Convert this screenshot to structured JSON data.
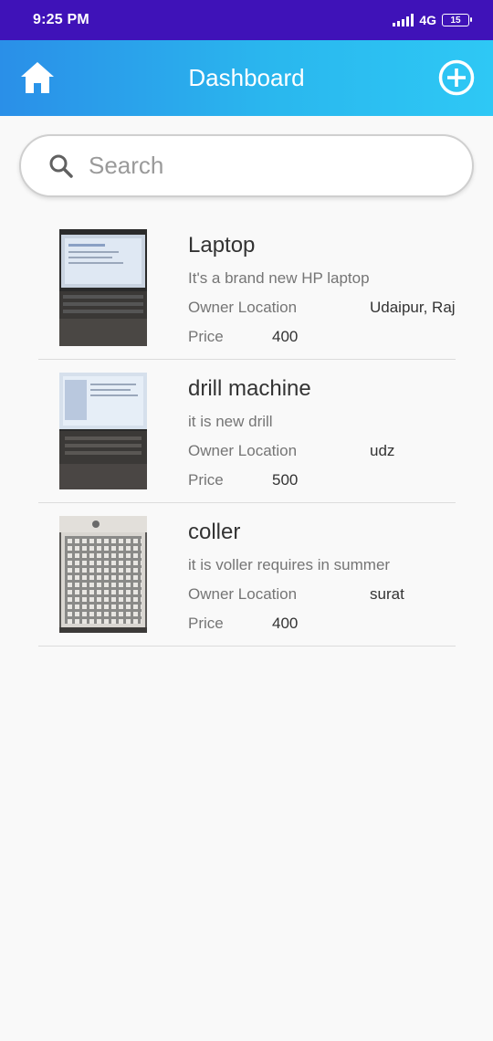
{
  "status_bar": {
    "time": "9:25 PM",
    "network": "4G",
    "battery": "15"
  },
  "app_bar": {
    "title": "Dashboard",
    "left_icon": "home-icon",
    "right_icon": "add-circle-icon",
    "gradient_start": "#2a8fe8",
    "gradient_end": "#2ec8f5"
  },
  "search": {
    "placeholder": "Search",
    "value": ""
  },
  "items": [
    {
      "title": "Laptop",
      "description": "It's a brand new HP laptop",
      "owner_label": "Owner Location",
      "owner_location": "Udaipur, Raj",
      "price_label": "Price",
      "price": "400",
      "image": "laptop-photo"
    },
    {
      "title": "drill machine",
      "description": "it is new drill",
      "owner_label": "Owner Location",
      "owner_location": "udz",
      "price_label": "Price",
      "price": "500",
      "image": "laptop-photo"
    },
    {
      "title": "coller",
      "description": "it is voller requires in summer",
      "owner_label": "Owner Location",
      "owner_location": "surat",
      "price_label": "Price",
      "price": "400",
      "image": "cooler-photo"
    }
  ]
}
